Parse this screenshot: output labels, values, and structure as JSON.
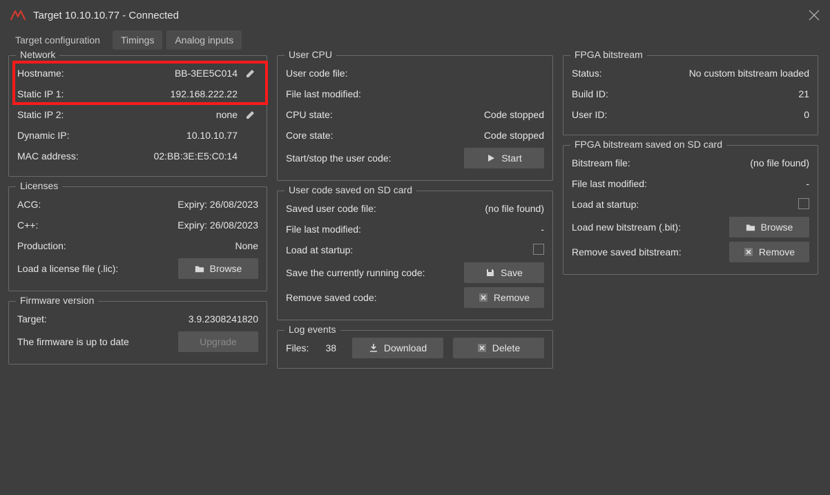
{
  "window": {
    "title": "Target 10.10.10.77 - Connected"
  },
  "tabs": {
    "config": "Target configuration",
    "timings": "Timings",
    "analog": "Analog inputs"
  },
  "network": {
    "legend": "Network",
    "hostname_lbl": "Hostname:",
    "hostname": "BB-3EE5C014",
    "sip1_lbl": "Static IP 1:",
    "sip1": "192.168.222.22",
    "sip2_lbl": "Static IP 2:",
    "sip2": "none",
    "dip_lbl": "Dynamic IP:",
    "dip": "10.10.10.77",
    "mac_lbl": "MAC address:",
    "mac": "02:BB:3E:E5:C0:14"
  },
  "licenses": {
    "legend": "Licenses",
    "acg_lbl": "ACG:",
    "acg": "Expiry: 26/08/2023",
    "cpp_lbl": "C++:",
    "cpp": "Expiry: 26/08/2023",
    "prod_lbl": "Production:",
    "prod": "None",
    "load_lbl": "Load a license file (.lic):",
    "browse": "Browse"
  },
  "firmware": {
    "legend": "Firmware version",
    "target_lbl": "Target:",
    "target": "3.9.2308241820",
    "uptodate": "The firmware is up to date",
    "upgrade": "Upgrade"
  },
  "ucpu": {
    "legend": "User CPU",
    "file_lbl": "User code file:",
    "mod_lbl": "File last modified:",
    "cpu_lbl": "CPU state:",
    "cpu": "Code stopped",
    "core_lbl": "Core state:",
    "core": "Code stopped",
    "startstop_lbl": "Start/stop the user code:",
    "start": "Start"
  },
  "ucode": {
    "legend": "User code saved on SD card",
    "saved_lbl": "Saved user code file:",
    "saved": "(no file found)",
    "mod_lbl": "File last modified:",
    "mod": "-",
    "load_lbl": "Load at startup:",
    "save_lbl": "Save the currently running code:",
    "save": "Save",
    "remove_lbl": "Remove saved code:",
    "remove": "Remove"
  },
  "log": {
    "legend": "Log events",
    "files_lbl": "Files:",
    "files": "38",
    "download": "Download",
    "delete": "Delete"
  },
  "fbit": {
    "legend": "FPGA bitstream",
    "status_lbl": "Status:",
    "status": "No custom bitstream loaded",
    "build_lbl": "Build ID:",
    "build": "21",
    "user_lbl": "User ID:",
    "user": "0"
  },
  "fsd": {
    "legend": "FPGA bitstream saved on SD card",
    "file_lbl": "Bitstream file:",
    "file": "(no file found)",
    "mod_lbl": "File last modified:",
    "mod": "-",
    "load_lbl": "Load at startup:",
    "new_lbl": "Load new bitstream (.bit):",
    "browse": "Browse",
    "remove_lbl": "Remove saved bitstream:",
    "remove": "Remove"
  }
}
